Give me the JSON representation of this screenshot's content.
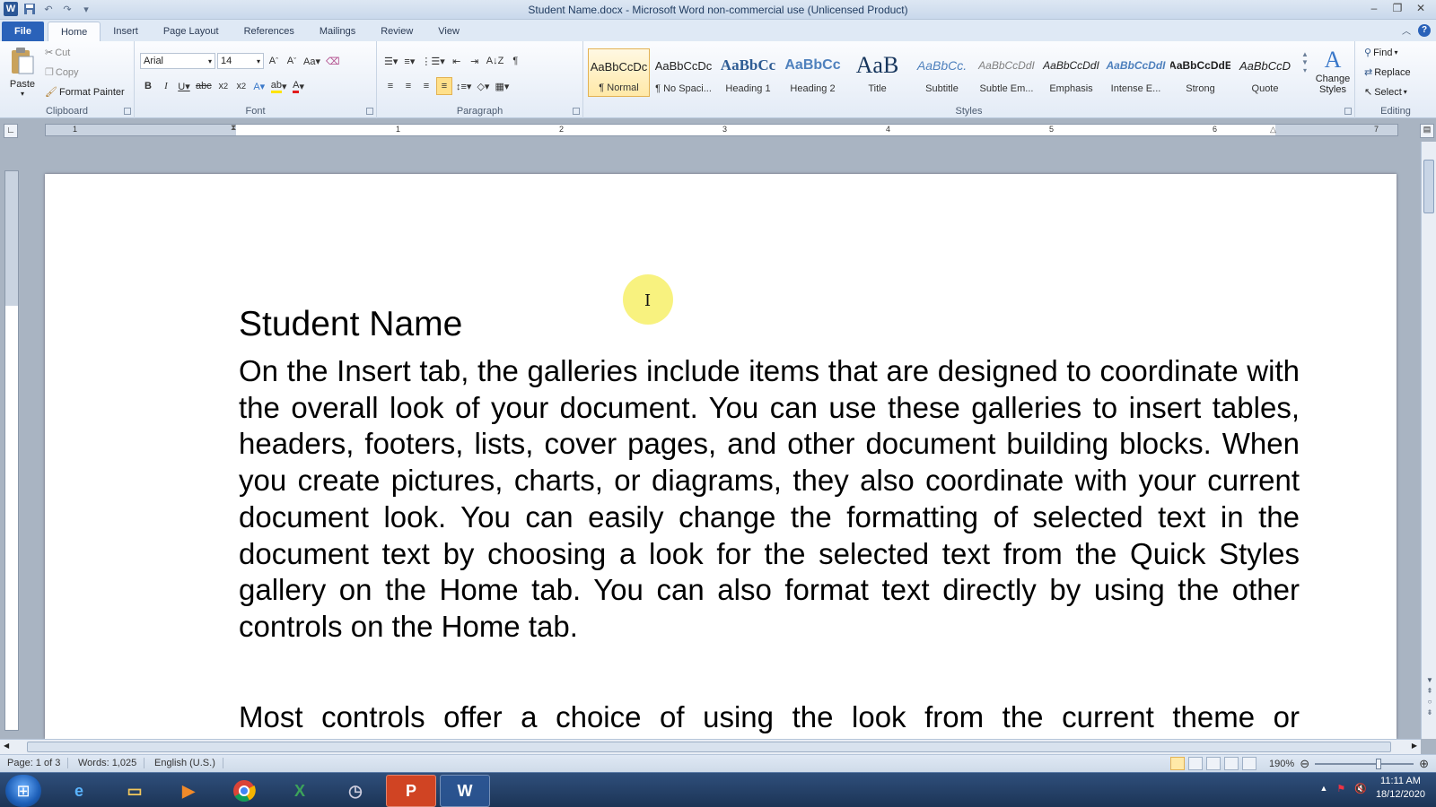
{
  "window": {
    "title": "Student Name.docx - Microsoft Word non-commercial use (Unlicensed Product)",
    "app_icon_letter": "W"
  },
  "tabs": [
    "File",
    "Home",
    "Insert",
    "Page Layout",
    "References",
    "Mailings",
    "Review",
    "View"
  ],
  "active_tab": "Home",
  "clipboard": {
    "paste": "Paste",
    "cut": "Cut",
    "copy": "Copy",
    "format_painter": "Format Painter",
    "label": "Clipboard"
  },
  "font": {
    "name": "Arial",
    "size": "14",
    "label": "Font"
  },
  "paragraph": {
    "label": "Paragraph"
  },
  "styles": {
    "label": "Styles",
    "items": [
      {
        "preview": "AaBbCcDc",
        "name": "¶ Normal"
      },
      {
        "preview": "AaBbCcDc",
        "name": "¶ No Spaci..."
      },
      {
        "preview": "AaBbCc",
        "name": "Heading 1"
      },
      {
        "preview": "AaBbCc",
        "name": "Heading 2"
      },
      {
        "preview": "AaB",
        "name": "Title"
      },
      {
        "preview": "AaBbCc.",
        "name": "Subtitle"
      },
      {
        "preview": "AaBbCcDdI",
        "name": "Subtle Em..."
      },
      {
        "preview": "AaBbCcDdI",
        "name": "Emphasis"
      },
      {
        "preview": "AaBbCcDdI",
        "name": "Intense E..."
      },
      {
        "preview": "AaBbCcDdE",
        "name": "Strong"
      },
      {
        "preview": "AaBbCcD",
        "name": "Quote"
      }
    ],
    "change_styles": "Change Styles"
  },
  "editing": {
    "find": "Find",
    "replace": "Replace",
    "select": "Select",
    "label": "Editing"
  },
  "ruler": {
    "numbers": [
      "1",
      "1",
      "2",
      "3",
      "4",
      "5",
      "6",
      "7"
    ]
  },
  "document": {
    "heading": "Student Name",
    "paragraphs": [
      "On the Insert tab, the galleries include items that are designed to coordinate with the overall look of your document. You can use these galleries to insert tables, headers, footers, lists, cover pages, and other document building blocks. When you create pictures, charts, or diagrams, they also coordinate with your current document look. You can easily change the formatting of selected text in the document text by choosing a look for the selected text from the Quick Styles gallery on the Home tab. You can also format text directly by using the other controls on the Home tab.",
      "Most controls offer a choice of using the look from the current theme or"
    ]
  },
  "status": {
    "page": "Page: 1 of 3",
    "words": "Words: 1,025",
    "language": "English (U.S.)",
    "zoom": "190%"
  },
  "taskbar": {
    "time": "11:11 AM",
    "date": "18/12/2020"
  }
}
